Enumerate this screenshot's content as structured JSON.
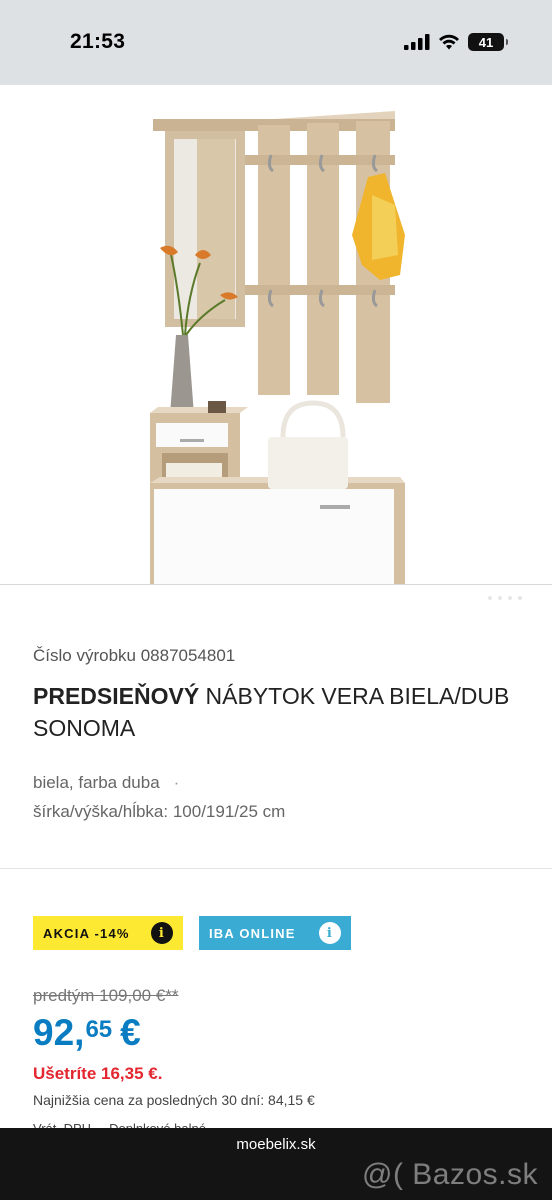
{
  "status_bar": {
    "time": "21:53",
    "battery": "41",
    "icons": [
      "cellular-signal-icon",
      "wifi-icon",
      "battery-icon"
    ]
  },
  "product": {
    "number_label": "Číslo výrobku 0887054801",
    "title_bold": "PREDSIEŇOVÝ",
    "title_rest": " NÁBYTOK VERA BIELA/DUB SONOMA",
    "attributes": [
      "biela, farba duba",
      "šírka/výška/hĺbka: 100/191/25 cm"
    ],
    "attribute_separator": "·"
  },
  "badges": {
    "akcia": "AKCIA -14%",
    "online": "IBA ONLINE",
    "info_glyph": "i"
  },
  "pricing": {
    "old_price": "predtým 109,00 €**",
    "price_int": "92,",
    "price_dec": "65",
    "currency": "€",
    "savings": "Ušetríte 16,35 €.",
    "lowest_price": "Najnižšia cena za posledných 30 dní: 84,15 €",
    "peek_text": "Vrát. DPH.... Doplnkové balné"
  },
  "browser": {
    "domain": "moebelix.sk"
  },
  "watermark": "@( Bazos.sk",
  "colors": {
    "status_bg": "#dde1e4",
    "accent_blue": "#0a7dc2",
    "badge_yellow": "#fde931",
    "badge_cyan": "#3aabd2",
    "savings_red": "#e3262f",
    "bottom_bar": "#141414"
  }
}
